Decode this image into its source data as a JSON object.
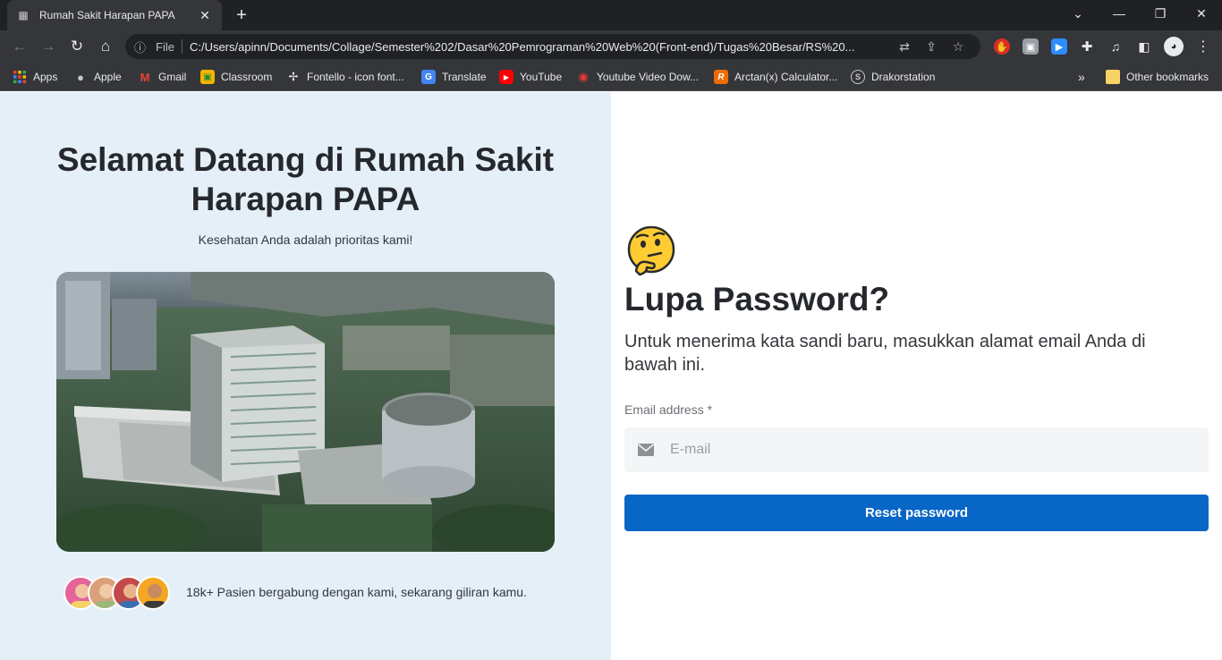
{
  "browser": {
    "tab_title": "Rumah Sakit Harapan PAPA",
    "new_tab": "+",
    "omnibox_scheme": "File",
    "url": "C:/Users/apinn/Documents/Collage/Semester%202/Dasar%20Pemrograman%20Web%20(Front-end)/Tugas%20Besar/RS%20...",
    "bookmarks": [
      {
        "label": "Apps",
        "icon": "apps-grid-icon",
        "color": "#e8453c"
      },
      {
        "label": "Apple",
        "icon": "apple-icon",
        "color": "#9aa0a6"
      },
      {
        "label": "Gmail",
        "icon": "gmail-icon",
        "color": "#ea4335"
      },
      {
        "label": "Classroom",
        "icon": "classroom-icon",
        "color": "#f4b400"
      },
      {
        "label": "Fontello - icon font...",
        "icon": "fontello-icon",
        "color": "#5f6368"
      },
      {
        "label": "Translate",
        "icon": "translate-icon",
        "color": "#4285f4"
      },
      {
        "label": "YouTube",
        "icon": "youtube-icon",
        "color": "#ff0000"
      },
      {
        "label": "Youtube Video Dow...",
        "icon": "download-icon",
        "color": "#e53935"
      },
      {
        "label": "Arctan(x) Calculator...",
        "icon": "calculator-icon",
        "color": "#ef6c00"
      },
      {
        "label": "Drakorstation",
        "icon": "drakor-icon",
        "color": "#5f6368"
      }
    ],
    "bookmarks_overflow": "»",
    "other_bookmarks": "Other bookmarks"
  },
  "left": {
    "title": "Selamat Datang di Rumah Sakit Harapan PAPA",
    "subtitle": "Kesehatan Anda adalah prioritas kami!",
    "join_text": "18k+ Pasien bergabung dengan kami, sekarang giliran kamu."
  },
  "right": {
    "emoji": "thinking-face-icon",
    "title": "Lupa Password?",
    "description": "Untuk menerima kata sandi baru, masukkan alamat email Anda di bawah ini.",
    "email_label": "Email address *",
    "email_placeholder": "E-mail",
    "email_value": "",
    "reset_button": "Reset password"
  },
  "colors": {
    "left_bg": "#e5eff8",
    "accent": "#0866c6",
    "input_bg": "#f4f5f7"
  }
}
